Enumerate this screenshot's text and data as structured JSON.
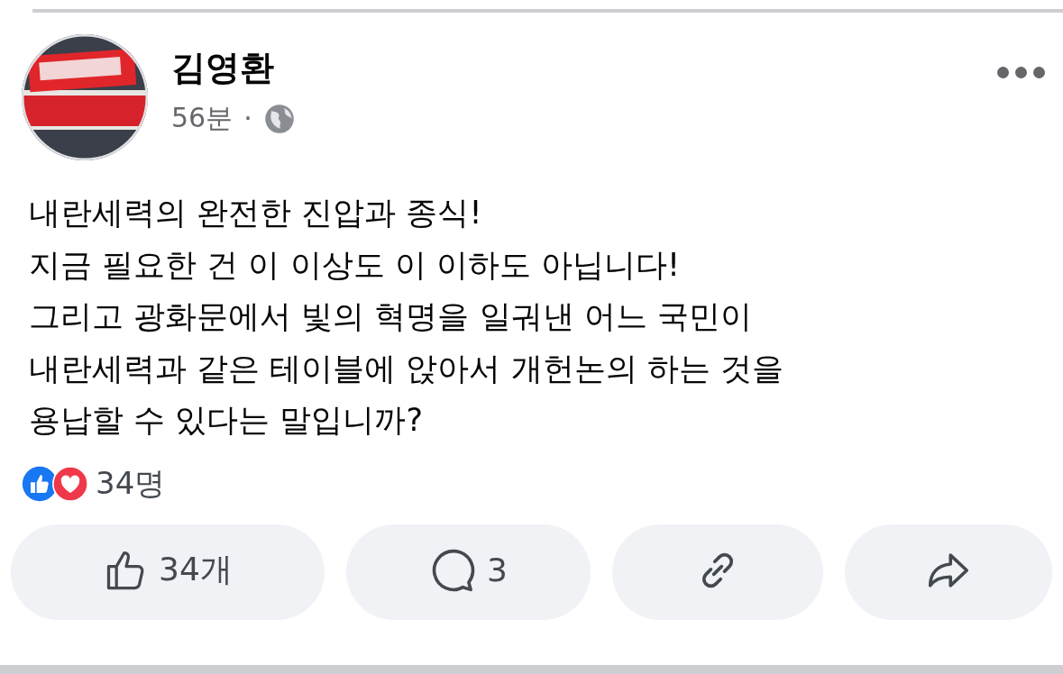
{
  "post": {
    "author": "김영환",
    "time": "56분",
    "separator": "·",
    "lines": [
      "내란세력의 완전한 진압과 종식!",
      "지금 필요한 건 이 이상도 이 이하도 아닙니다!",
      "그리고 광화문에서 빛의 혁명을 일궈낸 어느 국민이",
      "내란세력과 같은 테이블에 앉아서 개헌논의 하는 것을",
      "용납할 수 있다는 말입니까?"
    ],
    "reactions": {
      "count": "34명"
    },
    "actions": [
      {
        "kind": "like",
        "label": "34개"
      },
      {
        "kind": "comment",
        "label": "3"
      },
      {
        "kind": "link"
      },
      {
        "kind": "share"
      }
    ]
  }
}
